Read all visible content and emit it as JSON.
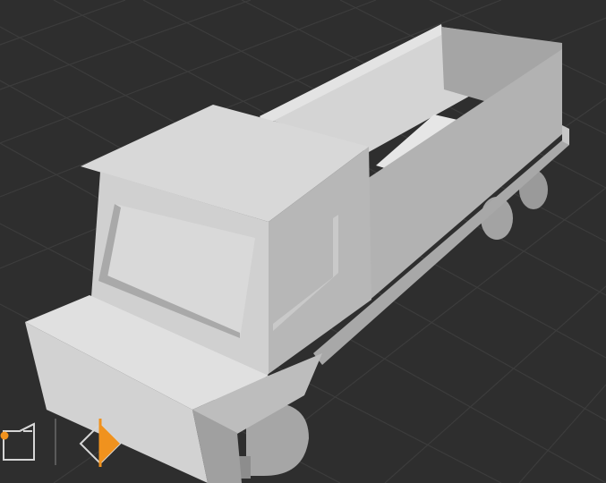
{
  "viewport": {
    "background": "#2e2e2e",
    "grid_color": "#3c3c3c",
    "model": "truck"
  },
  "toolbar": {
    "tools": [
      {
        "name": "view-cube",
        "icon": "cube-icon",
        "accent": "#f0921e"
      },
      {
        "name": "keyframe",
        "icon": "diamond-keyframe-icon",
        "accent": "#f0921e"
      }
    ]
  },
  "colors": {
    "model_light": "#d9d9d9",
    "model_mid": "#b5b5b5",
    "model_dark": "#8f8f8f",
    "accent": "#f0921e"
  }
}
